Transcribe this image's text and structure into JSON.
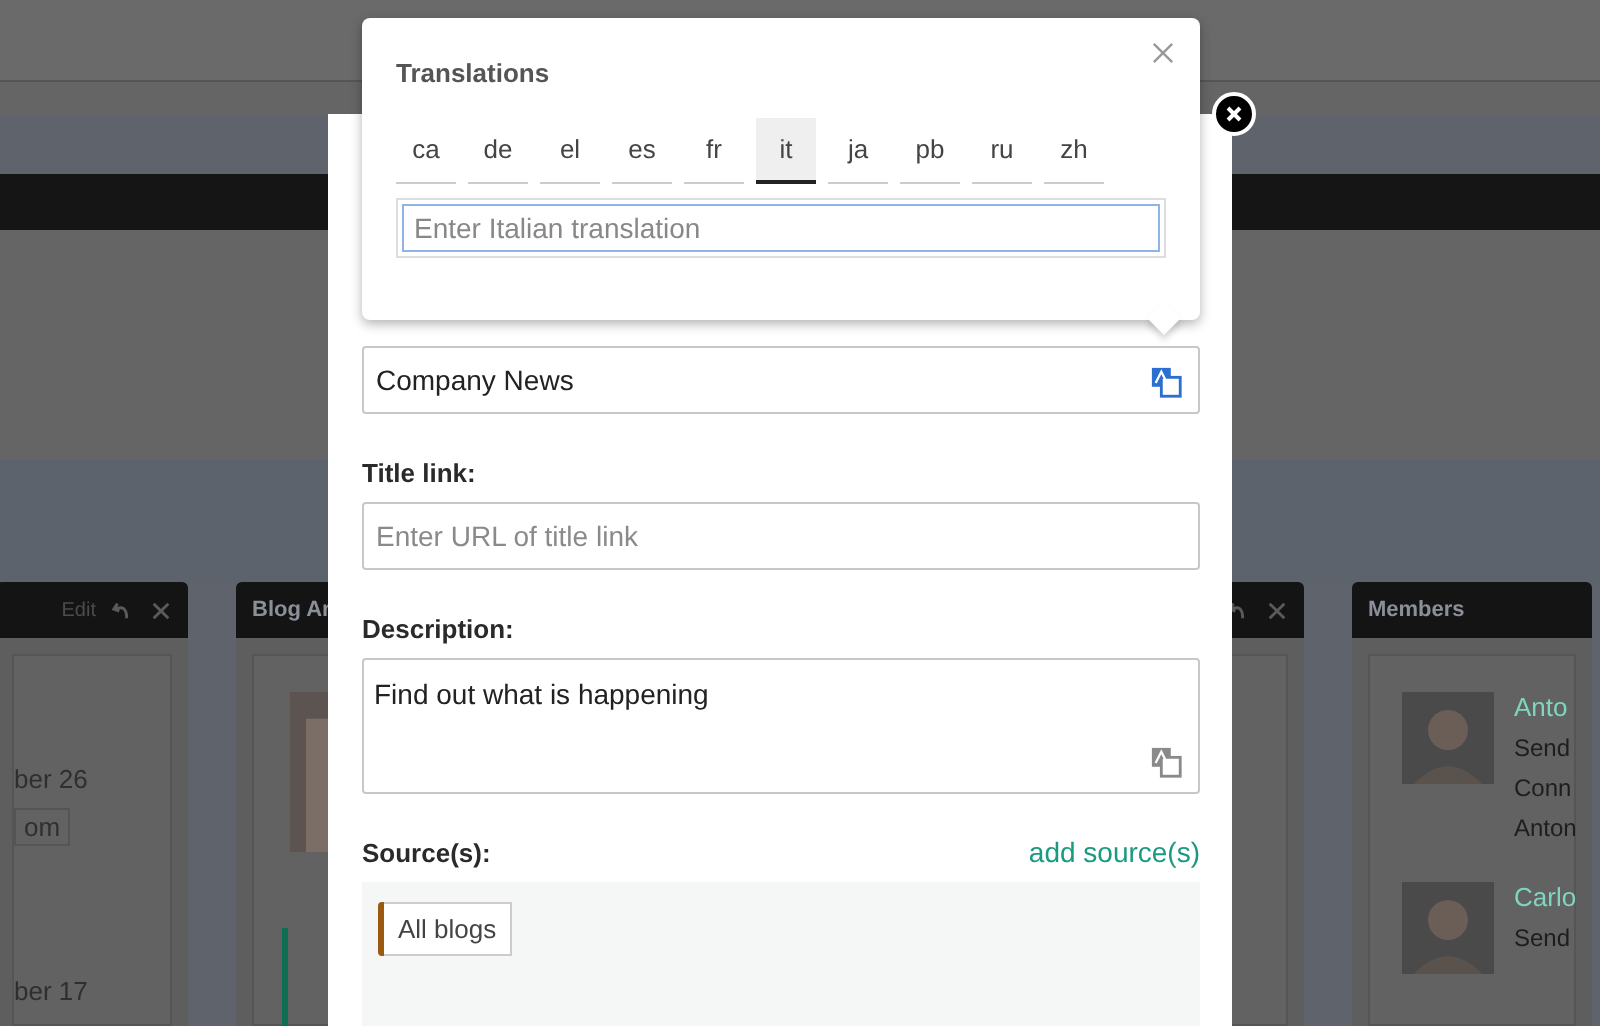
{
  "background": {
    "events_widget": {
      "action": "Edit",
      "lines": [
        "ber 26",
        "om",
        "ber 17"
      ]
    },
    "blog_widget": {
      "title": "Blog Ar"
    },
    "members_widget": {
      "title": "Members",
      "members": [
        {
          "name": "Anto",
          "lines": [
            "Send",
            "Conn",
            "Anton"
          ]
        },
        {
          "name": "Carlo",
          "lines": [
            "Send"
          ]
        }
      ]
    }
  },
  "popover": {
    "title": "Translations",
    "languages": [
      {
        "code": "ca",
        "selected": false
      },
      {
        "code": "de",
        "selected": false
      },
      {
        "code": "el",
        "selected": false
      },
      {
        "code": "es",
        "selected": false
      },
      {
        "code": "fr",
        "selected": false
      },
      {
        "code": "it",
        "selected": true
      },
      {
        "code": "ja",
        "selected": false
      },
      {
        "code": "pb",
        "selected": false
      },
      {
        "code": "ru",
        "selected": false
      },
      {
        "code": "zh",
        "selected": false
      }
    ],
    "input": {
      "placeholder": "Enter Italian translation"
    }
  },
  "dialog": {
    "fields": [
      {
        "kind": "text",
        "value": "Company News",
        "translate_active": true
      },
      {
        "kind": "text",
        "label": "Title link:",
        "placeholder": "Enter URL of title link"
      },
      {
        "kind": "textarea",
        "label": "Description:",
        "value": "Find out what is happening",
        "translate_active": false
      }
    ],
    "sources": {
      "label": "Source(s):",
      "add_link": "add source(s)",
      "items": [
        {
          "label": "All blogs",
          "color": "#9a5a12"
        }
      ]
    }
  }
}
